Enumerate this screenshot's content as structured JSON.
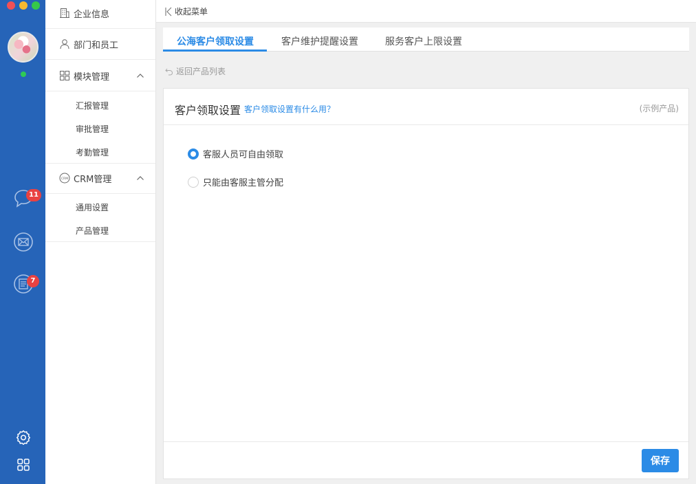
{
  "sidebar": {
    "company_info": "企业信息",
    "departments": "部门和员工",
    "module_mgmt": "模块管理",
    "module_sub": [
      "汇报管理",
      "审批管理",
      "考勤管理"
    ],
    "crm_mgmt": "CRM管理",
    "crm_icon_text": "CRM",
    "crm_sub": [
      "通用设置",
      "产品管理"
    ]
  },
  "rail": {
    "chat_badge": "11",
    "doc_badge": "7",
    "status": "online"
  },
  "topbar": {
    "collapse_label": "收起菜单"
  },
  "tabs": [
    {
      "label": "公海客户领取设置",
      "active": true
    },
    {
      "label": "客户维护提醒设置",
      "active": false
    },
    {
      "label": "服务客户上限设置",
      "active": false
    }
  ],
  "back_link": "返回产品列表",
  "panel": {
    "title": "客户领取设置",
    "help_link": "客户领取设置有什么用？",
    "example_tag": "(示例产品)",
    "options": [
      {
        "label": "客服人员可自由领取",
        "selected": true
      },
      {
        "label": "只能由客服主管分配",
        "selected": false
      }
    ],
    "save_label": "保存"
  },
  "colors": {
    "rail": "#2664b8",
    "accent": "#2b8be6",
    "badge": "#e94242"
  },
  "icons": [
    "settings-icon",
    "apps-grid-icon",
    "chat-icon",
    "mail-icon",
    "document-icon"
  ]
}
